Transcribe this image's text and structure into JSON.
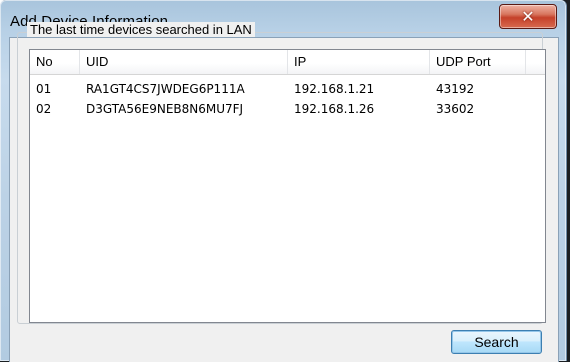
{
  "window": {
    "title": "Add Device Information",
    "close_glyph": "✕"
  },
  "group": {
    "legend": "The last time devices searched in LAN"
  },
  "table": {
    "headers": [
      "No",
      "UID",
      "IP",
      "UDP Port"
    ],
    "rows": [
      [
        "01",
        "RA1GT4CS7JWDEG6P111A",
        "192.168.1.21",
        "43192"
      ],
      [
        "02",
        "D3GTA56E9NEB8N6MU7FJ",
        "192.168.1.26",
        "33602"
      ]
    ]
  },
  "buttons": {
    "search_label": "Search"
  },
  "colors": {
    "close_button": "#c5412a",
    "title_bar": "#b7d0e6",
    "client_bg": "#f0f0f0"
  }
}
